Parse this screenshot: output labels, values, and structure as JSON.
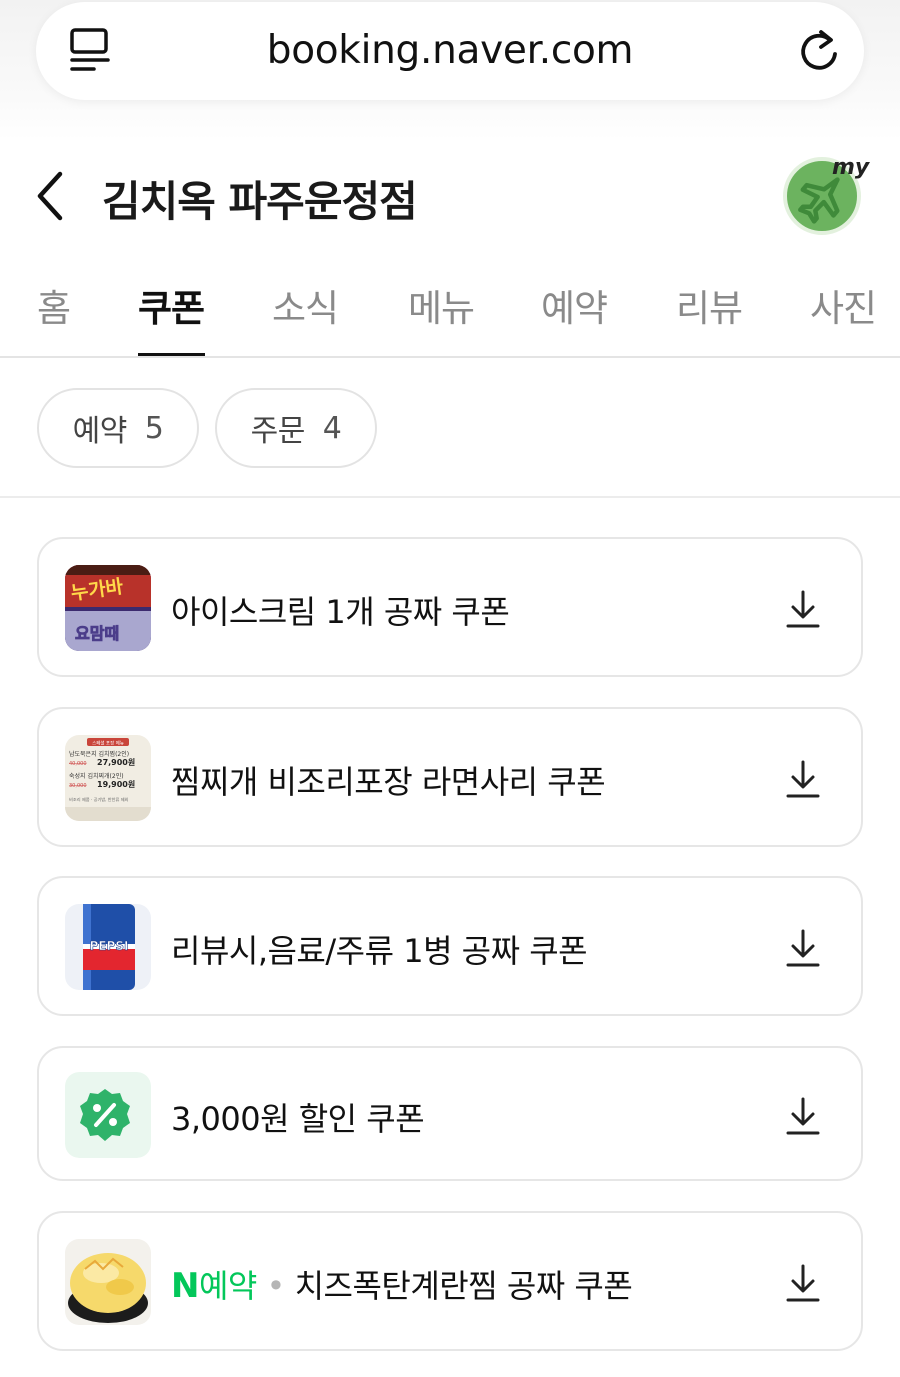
{
  "browser": {
    "url": "booking.naver.com",
    "icons": {
      "menu": "tab-list-icon",
      "reload": "reload-icon"
    }
  },
  "header": {
    "title": "김치옥 파주운정점",
    "back_icon": "chevron-left-icon",
    "my_badge": {
      "label": "my",
      "icon": "airplane-icon",
      "color": "#6cb35f"
    }
  },
  "tabs": [
    {
      "label": "홈",
      "active": false
    },
    {
      "label": "쿠폰",
      "active": true
    },
    {
      "label": "소식",
      "active": false
    },
    {
      "label": "메뉴",
      "active": false
    },
    {
      "label": "예약",
      "active": false
    },
    {
      "label": "리뷰",
      "active": false
    },
    {
      "label": "사진",
      "active": false
    }
  ],
  "filters": [
    {
      "label": "예약",
      "count": "5"
    },
    {
      "label": "주문",
      "count": "4"
    }
  ],
  "coupons": [
    {
      "title": "아이스크림 1개 공짜 쿠폰",
      "thumbnail": "ice-cream-photo"
    },
    {
      "title": "찜찌개 비조리포장 라면사리 쿠폰",
      "thumbnail": "menu-price-sign-photo",
      "thumb_text": {
        "header": "스페셜 포장 메뉴",
        "line1": "남도묵은지 김치찜(2인)",
        "price1_old": "40,000",
        "price1": "27,900원",
        "line2": "숙성지 김치찌개(2인)",
        "price2_old": "30,000",
        "price2": "19,900원",
        "footer": "비조리 제품 · 공기밥, 반찬류 제외"
      }
    },
    {
      "title": "리뷰시,음료/주류 1병 공짜 쿠폰",
      "thumbnail": "pepsi-can-photo",
      "thumb_text": "PEPSI"
    },
    {
      "title": "3,000원 할인 쿠폰",
      "thumbnail": "percent-badge-icon"
    },
    {
      "title": "치즈폭탄계란찜 공짜 쿠폰",
      "prefix_logo": "N",
      "prefix_label": "예약",
      "prefix_sep": "•",
      "thumbnail": "steamed-egg-photo"
    }
  ],
  "colors": {
    "naver_green": "#03c75a",
    "active_tab": "#111111",
    "inactive_tab": "#8a8a8a",
    "percent_badge": "#2fb36a"
  }
}
